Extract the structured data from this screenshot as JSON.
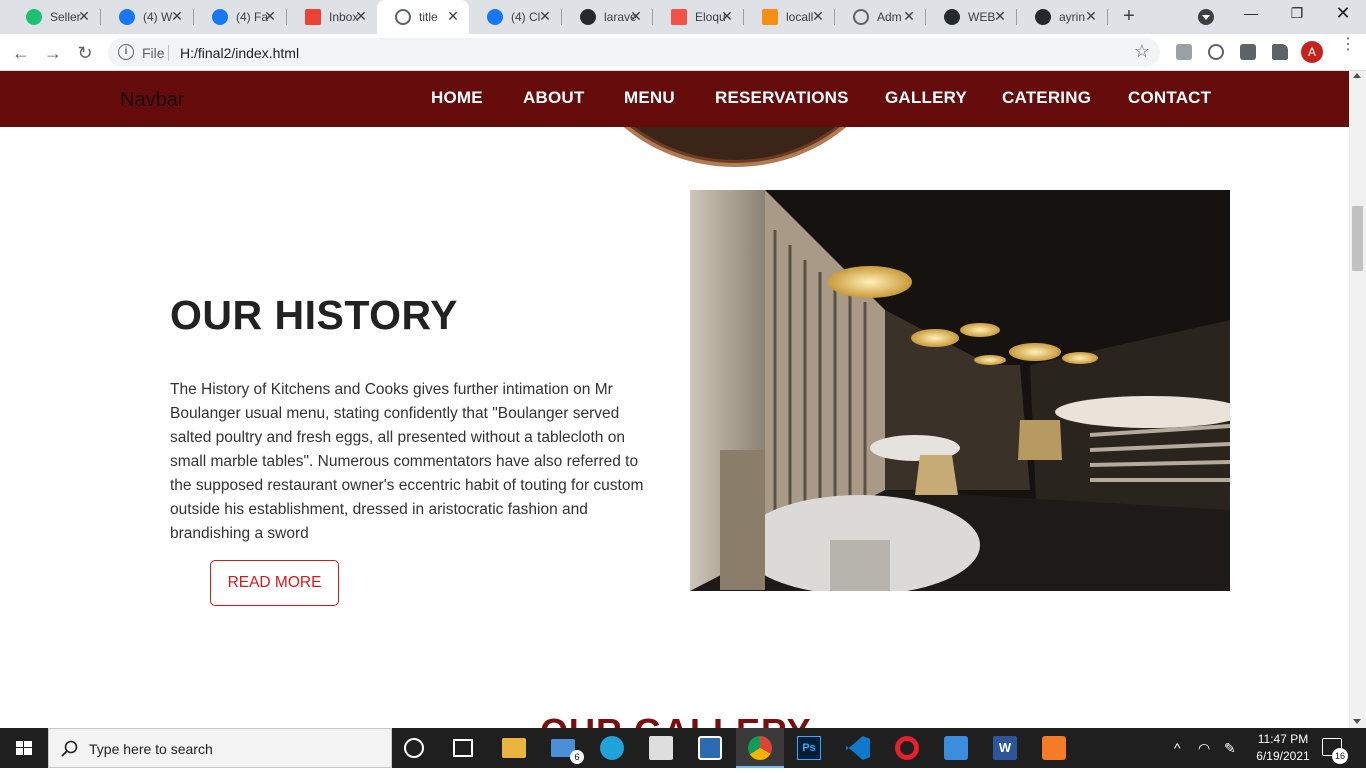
{
  "browser": {
    "tabs": [
      {
        "title": "Seller",
        "icon": "fiverr-icon",
        "color": "#1dbf73"
      },
      {
        "title": "(4) W",
        "icon": "facebook-icon",
        "color": "#1877f2"
      },
      {
        "title": "(4) Fa",
        "icon": "facebook-icon",
        "color": "#1877f2"
      },
      {
        "title": "Inbox",
        "icon": "gmail-icon",
        "color": "#ea4335"
      },
      {
        "title": "title",
        "icon": "globe-icon",
        "color": "#5f6368"
      },
      {
        "title": "(4) Cl",
        "icon": "facebook-icon",
        "color": "#1877f2"
      },
      {
        "title": "larave",
        "icon": "github-icon",
        "color": "#24292e"
      },
      {
        "title": "Eloqu",
        "icon": "laravel-icon",
        "color": "#f55247"
      },
      {
        "title": "locall",
        "icon": "phpmyadmin-icon",
        "color": "#f29111"
      },
      {
        "title": "Adm",
        "icon": "globe-icon",
        "color": "#5f6368"
      },
      {
        "title": "WEB",
        "icon": "github-icon",
        "color": "#24292e"
      },
      {
        "title": "ayrin",
        "icon": "github-icon",
        "color": "#24292e"
      }
    ],
    "address": {
      "scheme": "File",
      "url": "H:/final2/index.html"
    },
    "profile_initial": "A"
  },
  "site": {
    "brand": "Navbar",
    "nav": [
      "HOME",
      "ABOUT",
      "MENU",
      "RESERVATIONS",
      "GALLERY",
      "CATERING",
      "CONTACT"
    ],
    "history": {
      "title": "OUR HISTORY",
      "body": "The History of Kitchens and Cooks gives further intimation on Mr Boulanger usual menu, stating confidently that \"Boulanger served salted poultry and fresh eggs, all presented without a tablecloth on small marble tables\". Numerous commentators have also referred to the supposed restaurant owner's eccentric habit of touting for custom outside his establishment, dressed in aristocratic fashion and brandishing a sword",
      "button": "READ MORE"
    },
    "gallery_title": "OUR GALLERY",
    "colors": {
      "nav_bg": "#650b0b",
      "accent": "#d31a1a",
      "gallery_title": "#7a0d0d"
    }
  },
  "taskbar": {
    "search_placeholder": "Type here to search",
    "mail_badge": "6",
    "time": "11:47 PM",
    "date": "6/19/2021",
    "notifications": "16"
  }
}
